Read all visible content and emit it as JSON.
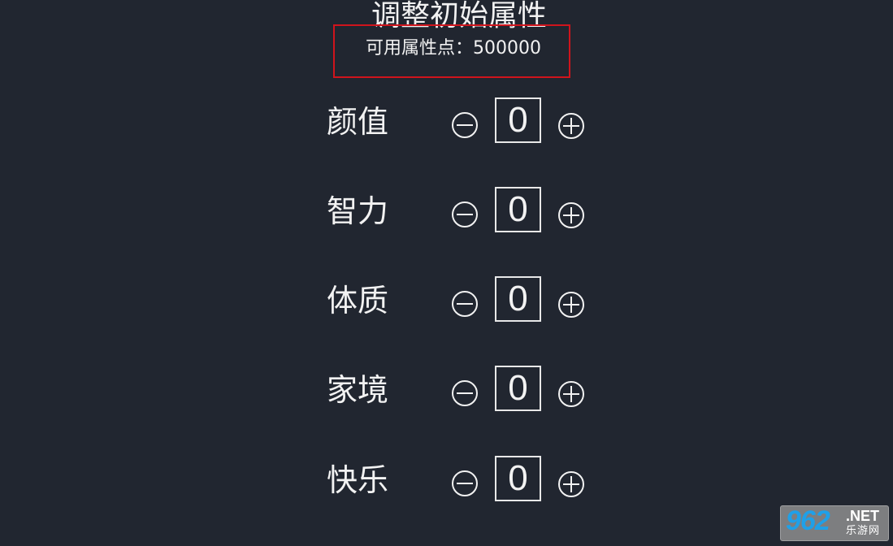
{
  "header": {
    "title": "调整初始属性",
    "points_label": "可用属性点：500000"
  },
  "attributes": [
    {
      "label": "颜值",
      "value": "0"
    },
    {
      "label": "智力",
      "value": "0"
    },
    {
      "label": "体质",
      "value": "0"
    },
    {
      "label": "家境",
      "value": "0"
    },
    {
      "label": "快乐",
      "value": "0"
    }
  ],
  "icons": {
    "decrement": "minus-circle-icon",
    "increment": "plus-circle-icon"
  },
  "watermark": {
    "number": "962",
    "domain": ".NET",
    "chinese": "乐游网"
  },
  "colors": {
    "background": "#212630",
    "highlight_box": "#d0141c",
    "text": "#f2f2f2"
  }
}
